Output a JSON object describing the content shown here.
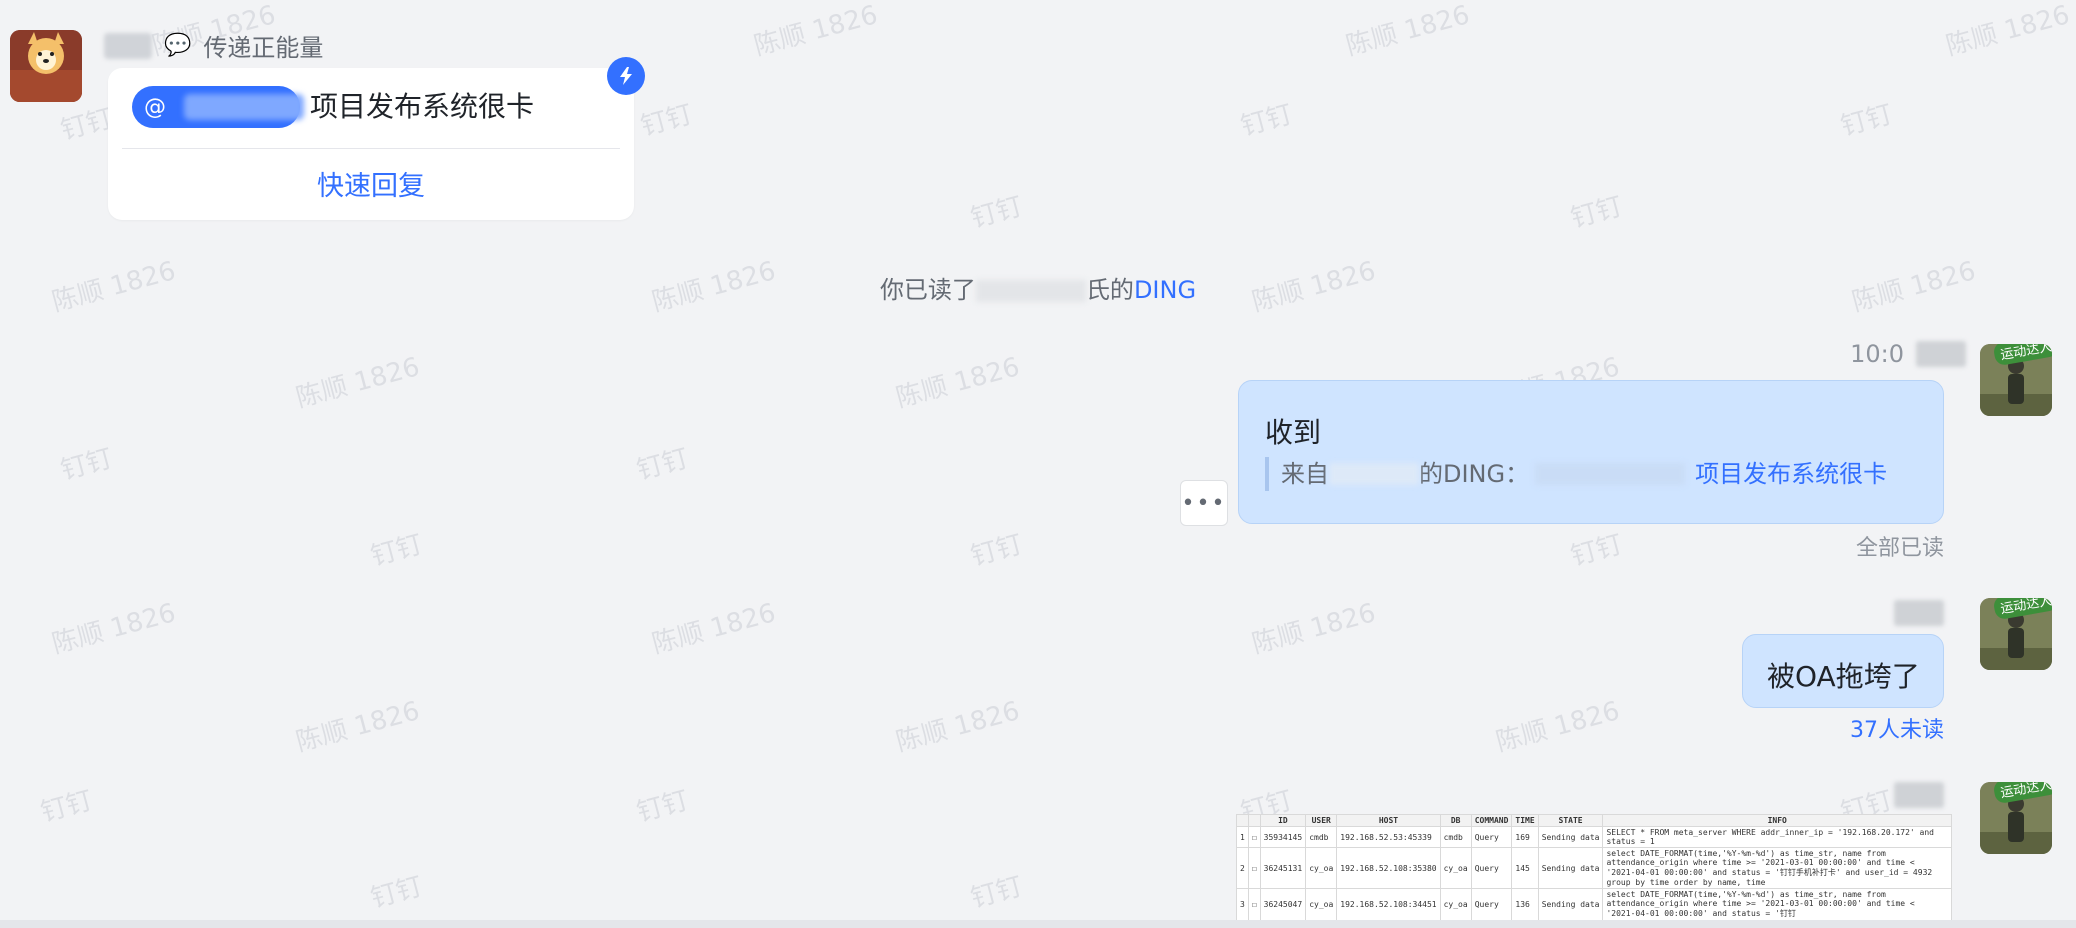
{
  "ding_message": {
    "signature": "传递正能量",
    "mention_prefix": "@",
    "content": "项目发布系统很卡",
    "quick_reply": "快速回复"
  },
  "system_message": {
    "prefix": "你已读了",
    "suffix_chars": "氏的",
    "link": "DING"
  },
  "messages": [
    {
      "time": "10:0",
      "text": "收到",
      "quote_prefix": "来自",
      "quote_mid": "的DING：",
      "quote_link": "项目发布系统很卡",
      "read_status": "全部已读"
    },
    {
      "text": "被OA拖垮了",
      "read_status": "37人未读"
    }
  ],
  "more_label": "•••",
  "avatar_badge": "运动达人",
  "watermarks": {
    "name": "陈顺 1826",
    "app": "钉钉"
  },
  "screenshot_table": {
    "headers": [
      "",
      "",
      "ID",
      "USER",
      "HOST",
      "DB",
      "COMMAND",
      "TIME",
      "STATE",
      "INFO"
    ],
    "rows": [
      [
        "1",
        "☐",
        "35934145",
        "cmdb",
        "192.168.52.53:45339",
        "cmdb",
        "Query",
        "169",
        "Sending data",
        "SELECT * FROM meta_server WHERE addr_inner_ip = '192.168.20.172' and status = 1"
      ],
      [
        "2",
        "☐",
        "36245131",
        "cy_oa",
        "192.168.52.108:35380",
        "cy_oa",
        "Query",
        "145",
        "Sending data",
        "select DATE_FORMAT(time,'%Y-%m-%d') as time_str, name from attendance_origin where time >= '2021-03-01 00:00:00' and time < '2021-04-01 00:00:00' and status = '钉钉手机补打卡' and user_id = 4932 group by time order by name, time"
      ],
      [
        "3",
        "☐",
        "36245047",
        "cy_oa",
        "192.168.52.108:34451",
        "cy_oa",
        "Query",
        "136",
        "Sending data",
        "select DATE_FORMAT(time,'%Y-%m-%d') as time_str, name from attendance_origin where time >= '2021-03-01 00:00:00' and time < '2021-04-01 00:00:00' and status = '钉钉"
      ]
    ]
  },
  "colors": {
    "accent": "#3370ff",
    "bubble": "#cfe4ff",
    "background": "#f2f3f5"
  }
}
